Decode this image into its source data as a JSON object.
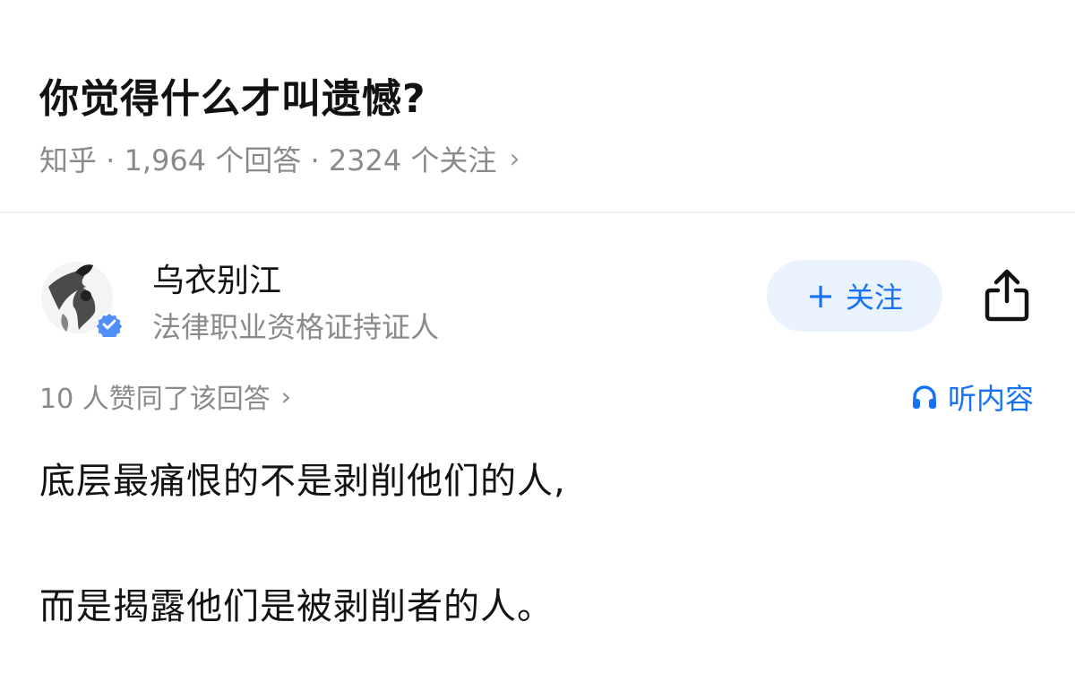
{
  "question": {
    "title": "你觉得什么才叫遗憾?",
    "meta": "知乎 · 1,964 个回答 · 2324 个关注",
    "meta_chevron": "›"
  },
  "author": {
    "name": "乌衣别江",
    "badge_text": "法律职业资格证持证人",
    "avatar_icon": "ink-painting-avatar",
    "verified_icon": "verified-check-icon"
  },
  "actions": {
    "follow_plus": "+",
    "follow_label": "关注",
    "share_icon": "share-icon"
  },
  "stats": {
    "upvotes_text": "10 人赞同了该回答",
    "chevron": "›"
  },
  "listen": {
    "label": "听内容",
    "icon": "headphones-icon"
  },
  "answer": {
    "lines": [
      "底层最痛恨的不是剥削他们的人,",
      "而是揭露他们是被剥削者的人。"
    ]
  },
  "colors": {
    "accent": "#1772f6",
    "follow_bg": "#eaf2fe",
    "text_primary": "#121212",
    "text_secondary": "#8a8a8a"
  }
}
